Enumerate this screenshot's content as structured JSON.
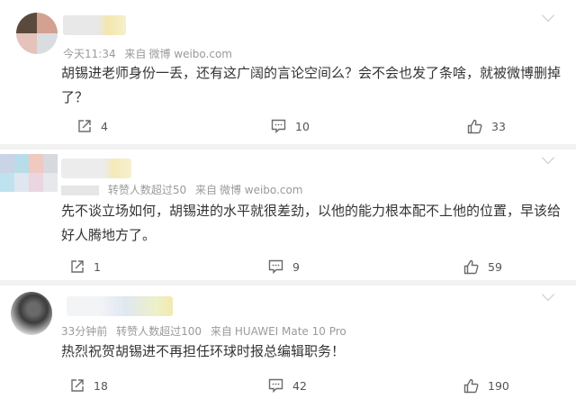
{
  "comments": [
    {
      "time": "今天11:34",
      "source_label": "来自",
      "source": "微博 weibo.com",
      "text": "胡锡进老师身份一丢，还有这广阔的言论空间么？会不会也发了条啥，就被微博删掉了？",
      "share_count": "4",
      "comment_count": "10",
      "like_count": "33"
    },
    {
      "time": "",
      "repost_note": "转赞人数超过50",
      "source_label": "来自",
      "source": "微博 weibo.com",
      "text": "先不谈立场如何，胡锡进的水平就很差劲，以他的能力根本配不上他的位置，早该给好人腾地方了。",
      "share_count": "1",
      "comment_count": "9",
      "like_count": "59"
    },
    {
      "time": "33分钟前",
      "repost_note": "转赞人数超过100",
      "source_label": "来自",
      "source": "HUAWEI Mate 10 Pro",
      "text": "热烈祝贺胡锡进不再担任环球时报总编辑职务！",
      "share_count": "18",
      "comment_count": "42",
      "like_count": "190"
    }
  ],
  "colors": {
    "text": "#333333",
    "meta": "#9a9a9a",
    "divider": "#f2f2f2",
    "icon": "#6b6b6b"
  },
  "icons": [
    "share-icon",
    "comment-icon",
    "like-icon",
    "chevron-down-icon"
  ]
}
